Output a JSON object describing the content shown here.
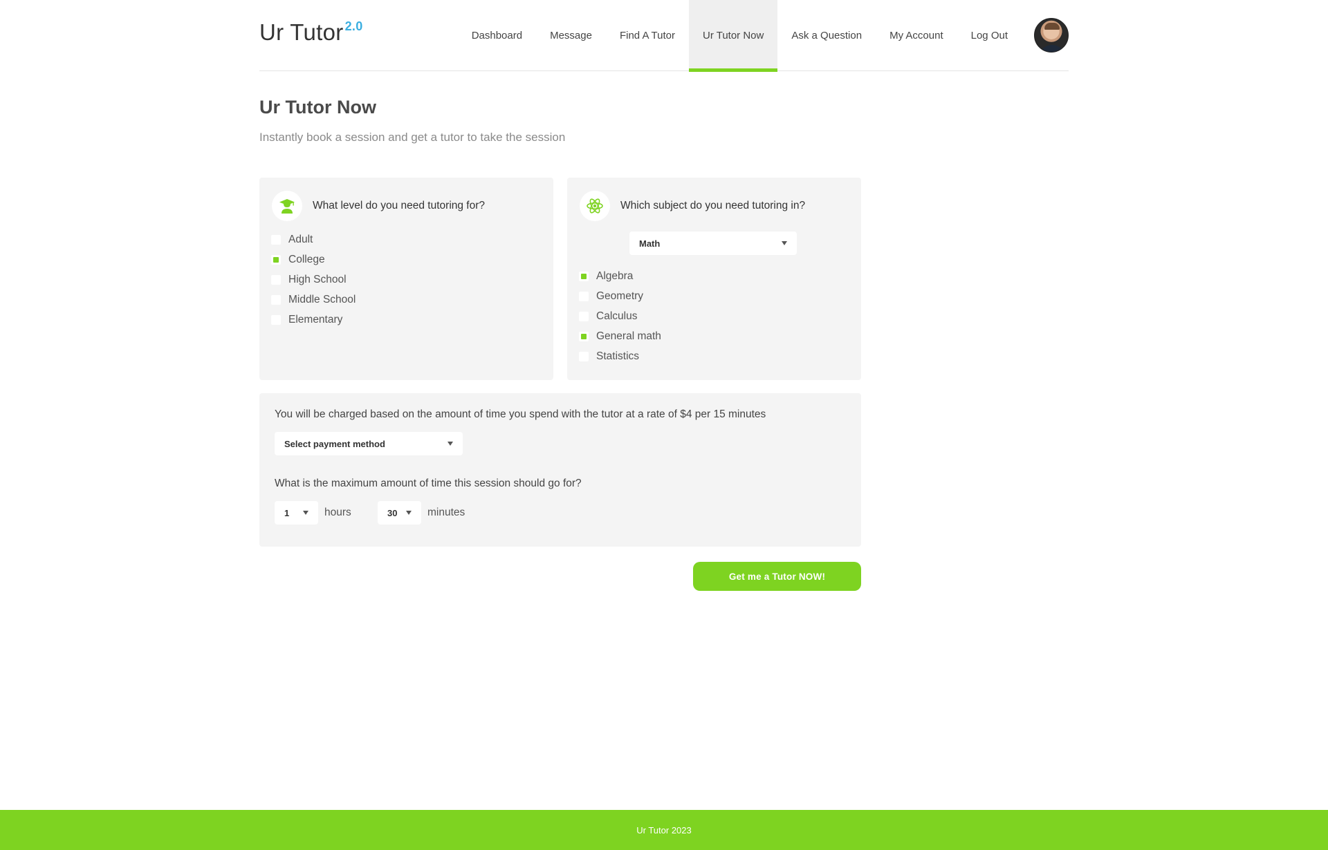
{
  "brand": {
    "name": "Ur Tutor",
    "version": "2.0"
  },
  "nav": {
    "items": [
      {
        "label": "Dashboard"
      },
      {
        "label": "Message"
      },
      {
        "label": "Find A Tutor"
      },
      {
        "label": "Ur Tutor Now",
        "active": true
      },
      {
        "label": "Ask a Question"
      },
      {
        "label": "My Account"
      },
      {
        "label": "Log Out"
      }
    ]
  },
  "page": {
    "title": "Ur Tutor Now",
    "subtitle": "Instantly book a session and get a tutor to take the session"
  },
  "level": {
    "question": "What level do you need tutoring for?",
    "icon": "graduate-icon",
    "options": [
      {
        "label": "Adult",
        "checked": false
      },
      {
        "label": "College",
        "checked": true
      },
      {
        "label": "High School",
        "checked": false
      },
      {
        "label": "Middle School",
        "checked": false
      },
      {
        "label": "Elementary",
        "checked": false
      }
    ]
  },
  "subject": {
    "question": "Which subject do you need tutoring in?",
    "icon": "atom-icon",
    "selected": "Math",
    "options": [
      {
        "label": "Algebra",
        "checked": true
      },
      {
        "label": "Geometry",
        "checked": false
      },
      {
        "label": "Calculus",
        "checked": false
      },
      {
        "label": "General math",
        "checked": true
      },
      {
        "label": "Statistics",
        "checked": false
      }
    ]
  },
  "payment": {
    "rate_text": "You will be charged based on the amount of time you spend with the tutor at a rate of $4 per 15 minutes",
    "method_placeholder": "Select payment method",
    "time_question": "What is the maximum amount of time this session should go for?",
    "hours_value": "1",
    "hours_label": "hours",
    "minutes_value": "30",
    "minutes_label": "minutes"
  },
  "cta": {
    "label": "Get me a Tutor NOW!"
  },
  "footer": {
    "text": "Ur Tutor 2023"
  },
  "colors": {
    "accent": "#7ed321",
    "brand_version": "#3aaee0",
    "card_bg": "#f4f4f4"
  }
}
